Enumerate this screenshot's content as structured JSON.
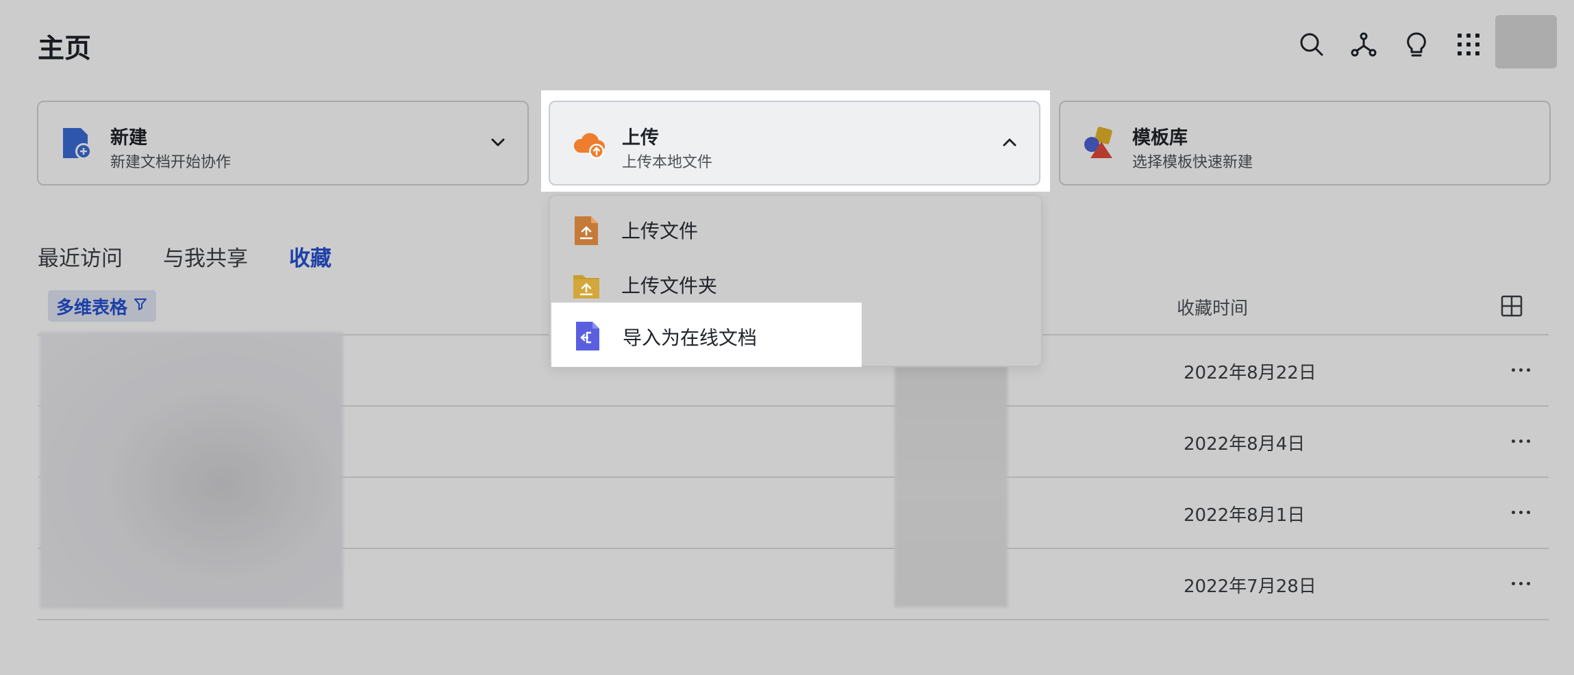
{
  "header": {
    "title": "主页",
    "icons": [
      "search-icon",
      "network-icon",
      "lightbulb-icon",
      "apps-grid-icon"
    ]
  },
  "cards": [
    {
      "title": "新建",
      "subtitle": "新建文档开始协作",
      "icon": "new-doc-icon",
      "chevron": "chevron-down-icon"
    },
    {
      "title": "上传",
      "subtitle": "上传本地文件",
      "icon": "cloud-upload-icon",
      "chevron": "chevron-up-icon"
    },
    {
      "title": "模板库",
      "subtitle": "选择模板快速新建",
      "icon": "template-shapes-icon"
    }
  ],
  "upload_menu": {
    "items": [
      {
        "label": "上传文件",
        "icon": "upload-file-icon"
      },
      {
        "label": "上传文件夹",
        "icon": "upload-folder-icon"
      },
      {
        "label": "导入为在线文档",
        "icon": "import-doc-icon"
      }
    ]
  },
  "tabs": [
    {
      "label": "最近访问"
    },
    {
      "label": "与我共享"
    },
    {
      "label": "收藏",
      "selected": true
    }
  ],
  "filter": {
    "label": "多维表格"
  },
  "table": {
    "column_time": "收藏时间",
    "rows": [
      {
        "date": "2022年8月22日"
      },
      {
        "date": "2022年8月4日"
      },
      {
        "date": "2022年8月1日"
      },
      {
        "date": "2022年7月28日"
      }
    ]
  },
  "colors": {
    "accent": "#2450d3",
    "upload_orange": "#ee7d2d",
    "new_blue": "#3a6cd8",
    "import_purple": "#5a5fe0"
  }
}
